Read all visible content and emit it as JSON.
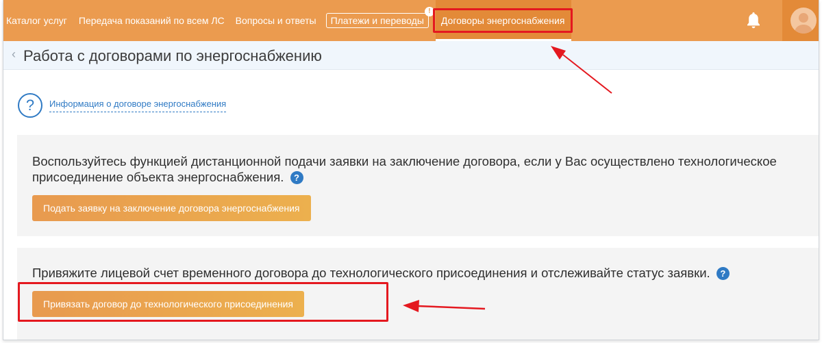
{
  "nav": {
    "items": [
      {
        "label": "Каталог услуг"
      },
      {
        "label": "Передача показаний по всем ЛС"
      },
      {
        "label": "Вопросы и ответы"
      },
      {
        "label": "Платежи и переводы",
        "badge": "!"
      },
      {
        "label": "Договоры энергоснабжения",
        "active": true
      }
    ],
    "bell_icon": "bell-icon",
    "avatar_icon": "user-avatar-icon"
  },
  "header": {
    "back_icon": "chevron-left-icon",
    "title": "Работа с договорами по энергоснабжению"
  },
  "info": {
    "icon": "question-circle-icon",
    "icon_glyph": "?",
    "link": "Информация о договоре энергоснабжения"
  },
  "cards": [
    {
      "text_line1": "Воспользуйтесь функцией дистанционной подачи заявки на заключение договора, если у Вас осуществлено технологическое",
      "text_line2": "присоединение объекта энергоснабжения.",
      "help_glyph": "?",
      "button": "Подать заявку на заключение договора энергоснабжения"
    },
    {
      "text_line1": "Привяжите лицевой счет временного договора до технологического присоединения и отслеживайте статус заявки.",
      "help_glyph": "?",
      "button": "Привязать договор до технологического присоединения"
    }
  ],
  "colors": {
    "topbar": "#eb9b4f",
    "accent_blue": "#2f7ac4",
    "annotation_red": "#e4181f"
  }
}
